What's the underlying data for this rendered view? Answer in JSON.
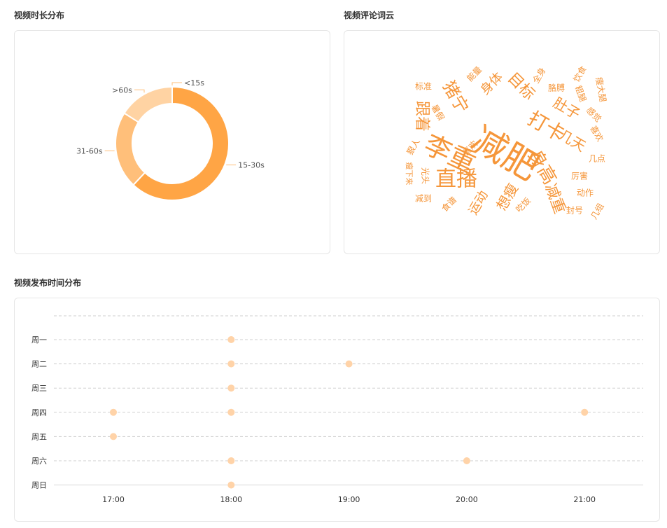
{
  "sections": {
    "duration_title": "视频时长分布",
    "wordcloud_title": "视频评论词云",
    "publish_title": "视频发布时间分布"
  },
  "colors": {
    "accent": "#ffa545",
    "mid": "#ffbf7a",
    "light": "#ffd3a3",
    "dot": "#ffd3a8",
    "word": "#f5963a"
  },
  "chart_data": [
    {
      "type": "pie",
      "variant": "donut",
      "categories": [
        "<15s",
        "15-30s",
        "31-60s",
        ">60s"
      ],
      "values": [
        0,
        62,
        22,
        16
      ],
      "label_positions": {
        "<15s": "top",
        "15-30s": "right",
        "31-60s": "left",
        ">60s": "top-left"
      }
    },
    {
      "type": "wordcloud",
      "words": [
        "减肥",
        "李重",
        "直播",
        "打卡",
        "身高",
        "猪宁",
        "目标",
        "跟着",
        "肚子",
        "几天",
        "减重",
        "想瘦",
        "运动",
        "标准",
        "身体",
        "能量",
        "全身",
        "饮食",
        "瘦大腿",
        "胳膊",
        "粗腿",
        "感觉",
        "喜欢",
        "动作",
        "厉害",
        "几点",
        "减到",
        "食谱",
        "吃饭",
        "光头",
        "封号",
        "几组",
        "瘦下来",
        "狠人",
        "暑假",
        "喜欢"
      ]
    },
    {
      "type": "scatter",
      "x_ticks": [
        "17:00",
        "18:00",
        "19:00",
        "20:00",
        "21:00"
      ],
      "y_categories": [
        "周一",
        "周二",
        "周三",
        "周四",
        "周五",
        "周六",
        "周日"
      ],
      "points": [
        {
          "x": "18:00",
          "y": "周一"
        },
        {
          "x": "18:00",
          "y": "周二"
        },
        {
          "x": "19:00",
          "y": "周二"
        },
        {
          "x": "18:00",
          "y": "周三"
        },
        {
          "x": "17:00",
          "y": "周四"
        },
        {
          "x": "18:00",
          "y": "周四"
        },
        {
          "x": "21:00",
          "y": "周四"
        },
        {
          "x": "17:00",
          "y": "周五"
        },
        {
          "x": "18:00",
          "y": "周六"
        },
        {
          "x": "20:00",
          "y": "周六"
        },
        {
          "x": "18:00",
          "y": "周日"
        }
      ],
      "grid": "dashed"
    }
  ]
}
